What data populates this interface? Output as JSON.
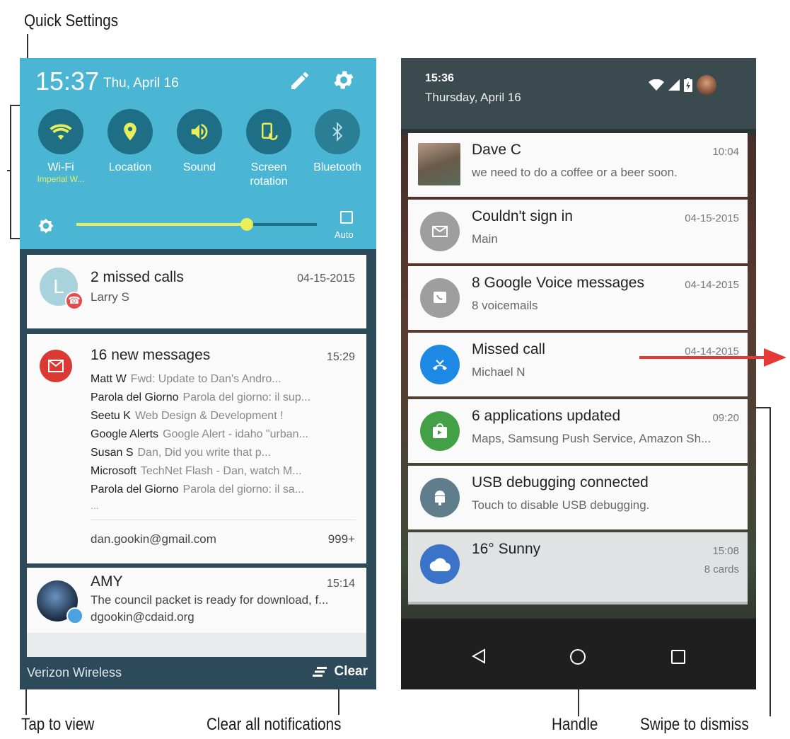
{
  "callouts": {
    "quick_settings": "Quick Settings",
    "tap_to_view": "Tap to view",
    "clear_all": "Clear all notifications",
    "handle": "Handle",
    "swipe_to_dismiss": "Swipe to dismiss"
  },
  "left_phone": {
    "quick_settings": {
      "time": "15:37",
      "date": "Thu, April 16",
      "toggles": [
        {
          "label": "Wi-Fi",
          "sub": "Imperial W...",
          "icon": "wifi-icon"
        },
        {
          "label": "Location",
          "sub": "",
          "icon": "location-icon"
        },
        {
          "label": "Sound",
          "sub": "",
          "icon": "sound-icon"
        },
        {
          "label": "Screen rotation",
          "sub": "",
          "icon": "screen-rotation-icon"
        },
        {
          "label": "Bluetooth",
          "sub": "",
          "icon": "bluetooth-icon"
        }
      ],
      "brightness_level": 0.71,
      "auto_label": "Auto"
    },
    "notifications": {
      "missed_calls": {
        "title": "2 missed calls",
        "time": "04-15-2015",
        "sub": "Larry S",
        "avatar_letter": "L"
      },
      "gmail": {
        "title": "16 new messages",
        "time": "15:29",
        "rows": [
          {
            "sender": "Matt W",
            "snippet": "Fwd: Update to Dan's Andro..."
          },
          {
            "sender": "Parola del Giorno",
            "snippet": "Parola del giorno: il sup..."
          },
          {
            "sender": "Seetu K",
            "snippet": "Web Design & Development !"
          },
          {
            "sender": "Google Alerts",
            "snippet": "Google Alert - idaho \"urban..."
          },
          {
            "sender": "Susan S",
            "snippet": "Dan, Did you write that p..."
          },
          {
            "sender": "Microsoft",
            "snippet": "TechNet Flash - Dan, watch M..."
          },
          {
            "sender": "Parola del Giorno",
            "snippet": "Parola del giorno: il sa..."
          }
        ],
        "ellipsis": "...",
        "account": "dan.gookin@gmail.com",
        "count": "999+"
      },
      "amy": {
        "title": "AMY",
        "time": "15:14",
        "text": "The council packet is ready for download, f...",
        "account": "dgookin@cdaid.org"
      }
    },
    "bottom": {
      "carrier": "Verizon Wireless",
      "clear_label": "Clear"
    }
  },
  "right_phone": {
    "header": {
      "time": "15:36",
      "date": "Thursday, April 16"
    },
    "notifications": [
      {
        "title": "Dave C",
        "time": "10:04",
        "sub": "we need to do a coffee or a beer soon.",
        "icon": "dave-photo",
        "color": "#7a6a5a"
      },
      {
        "title": "Couldn't sign in",
        "time": "04-15-2015",
        "sub": "Main",
        "icon": "mail-icon",
        "color": "#9e9e9e"
      },
      {
        "title": "8 Google Voice messages",
        "time": "04-14-2015",
        "sub": "8 voicemails",
        "icon": "voicemail-icon",
        "color": "#9e9e9e"
      },
      {
        "title": "Missed call",
        "time": "04-14-2015",
        "sub": "Michael N",
        "icon": "missed-call-icon",
        "color": "#1e88e5"
      },
      {
        "title": "6 applications updated",
        "time": "09:20",
        "sub": "Maps, Samsung Push Service, Amazon Sh...",
        "icon": "play-store-icon",
        "color": "#43a047"
      },
      {
        "title": "USB debugging connected",
        "time": "",
        "sub": "Touch to disable USB debugging.",
        "icon": "android-icon",
        "color": "#607d8b"
      }
    ],
    "weather": {
      "title": "16° Sunny",
      "time": "15:08",
      "sub": "8 cards"
    }
  },
  "colors": {
    "qs_bg": "#4ab6d4",
    "qs_circle": "#1e6f86",
    "accent_yellow": "#e8ef5a",
    "swipe_arrow": "#e53935"
  }
}
